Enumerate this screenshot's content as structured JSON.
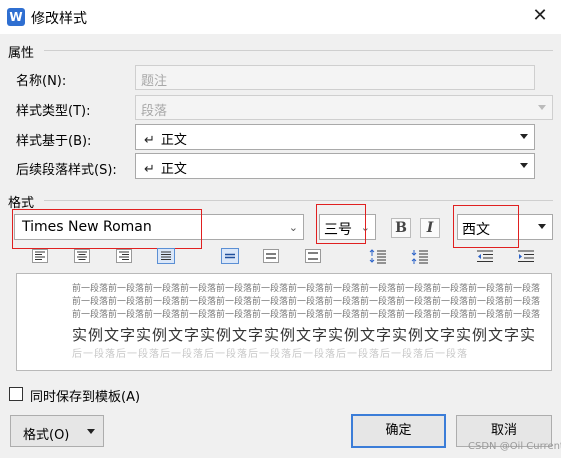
{
  "window": {
    "title": "修改样式",
    "app_icon_letter": "W",
    "close_glyph": "✕"
  },
  "properties": {
    "section_title": "属性",
    "name": {
      "label": "名称(N):",
      "value": "题注"
    },
    "style_type": {
      "label": "样式类型(T):",
      "value": "段落"
    },
    "based_on": {
      "label": "样式基于(B):",
      "glyph": "↵",
      "value": "正文"
    },
    "next_style": {
      "label": "后续段落样式(S):",
      "glyph": "↵",
      "value": "正文"
    }
  },
  "format": {
    "section_title": "格式",
    "font_name": "Times New Roman",
    "font_size": "三号",
    "bold_label": "B",
    "italic_label": "I",
    "script": "西文"
  },
  "preview": {
    "prev_lines": [
      "前一段落前一段落前一段落前一段落前一段落前一段落前一段落前一段落前一段落前一段落前一段落前一段落前一段落",
      "前一段落前一段落前一段落前一段落前一段落前一段落前一段落前一段落前一段落前一段落前一段落前一段落前一段落",
      "前一段落前一段落前一段落前一段落前一段落前一段落前一段落前一段落前一段落前一段落前一段落前一段落前一段落"
    ],
    "sample_text": "实例文字实例文字实例文字实例文字实例文字实例文字实例文字实",
    "faint_text": "后一段落后一段落后一段落后一段落后一段落后一段落后一段落后一段落后一段落"
  },
  "template_checkbox": {
    "label": "同时保存到模板(A)",
    "checked": false
  },
  "buttons": {
    "format": "格式(O)",
    "ok": "确定",
    "cancel": "取消"
  },
  "watermark": "CSDN @Oil Current",
  "colors": {
    "highlight_box": "#e02020",
    "primary_border": "#3b7dd8",
    "selected_tool": "#dbe7f8"
  }
}
